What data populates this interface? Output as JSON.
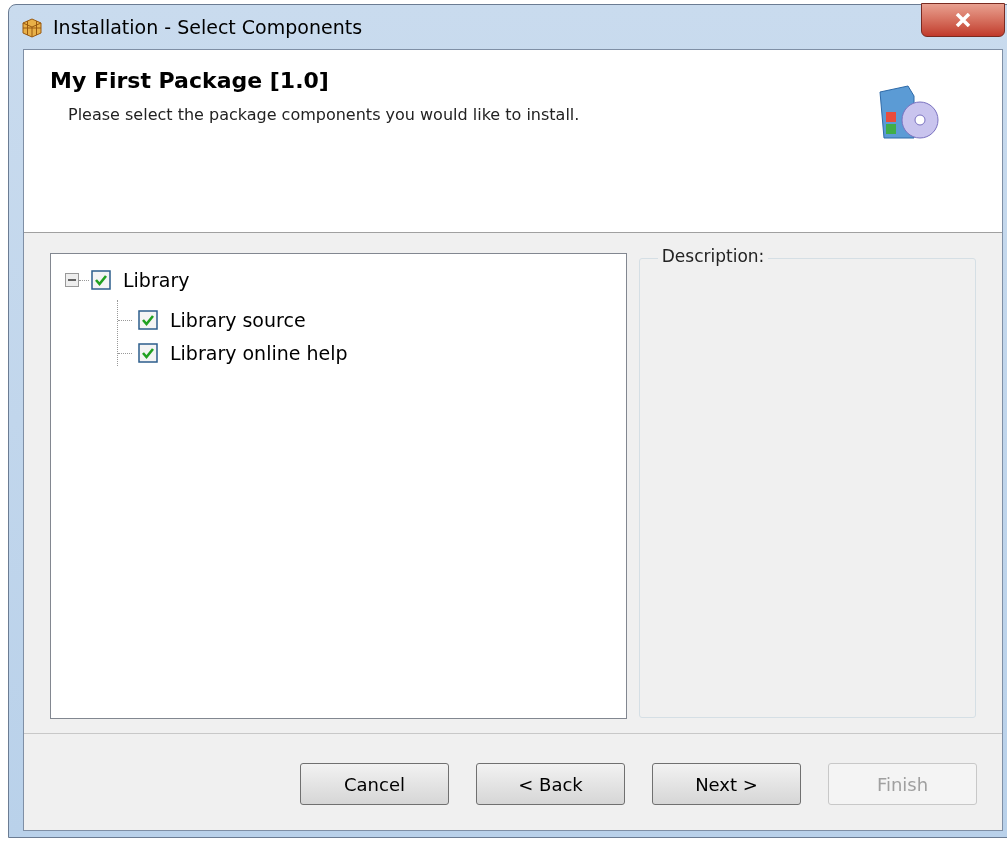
{
  "window": {
    "title": "Installation - Select Components"
  },
  "header": {
    "title": "My First Package [1.0]",
    "subtitle": "Please select the package components you would like to install."
  },
  "tree": [
    {
      "label": "Library",
      "checked": true,
      "expanded": true,
      "children": [
        {
          "label": "Library source",
          "checked": true
        },
        {
          "label": "Library online help",
          "checked": true
        }
      ]
    }
  ],
  "description": {
    "label": "Description:"
  },
  "buttons": [
    {
      "label": "Cancel",
      "disabled": false
    },
    {
      "label": "< Back",
      "disabled": false
    },
    {
      "label": "Next >",
      "disabled": false
    },
    {
      "label": "Finish",
      "disabled": true
    }
  ]
}
